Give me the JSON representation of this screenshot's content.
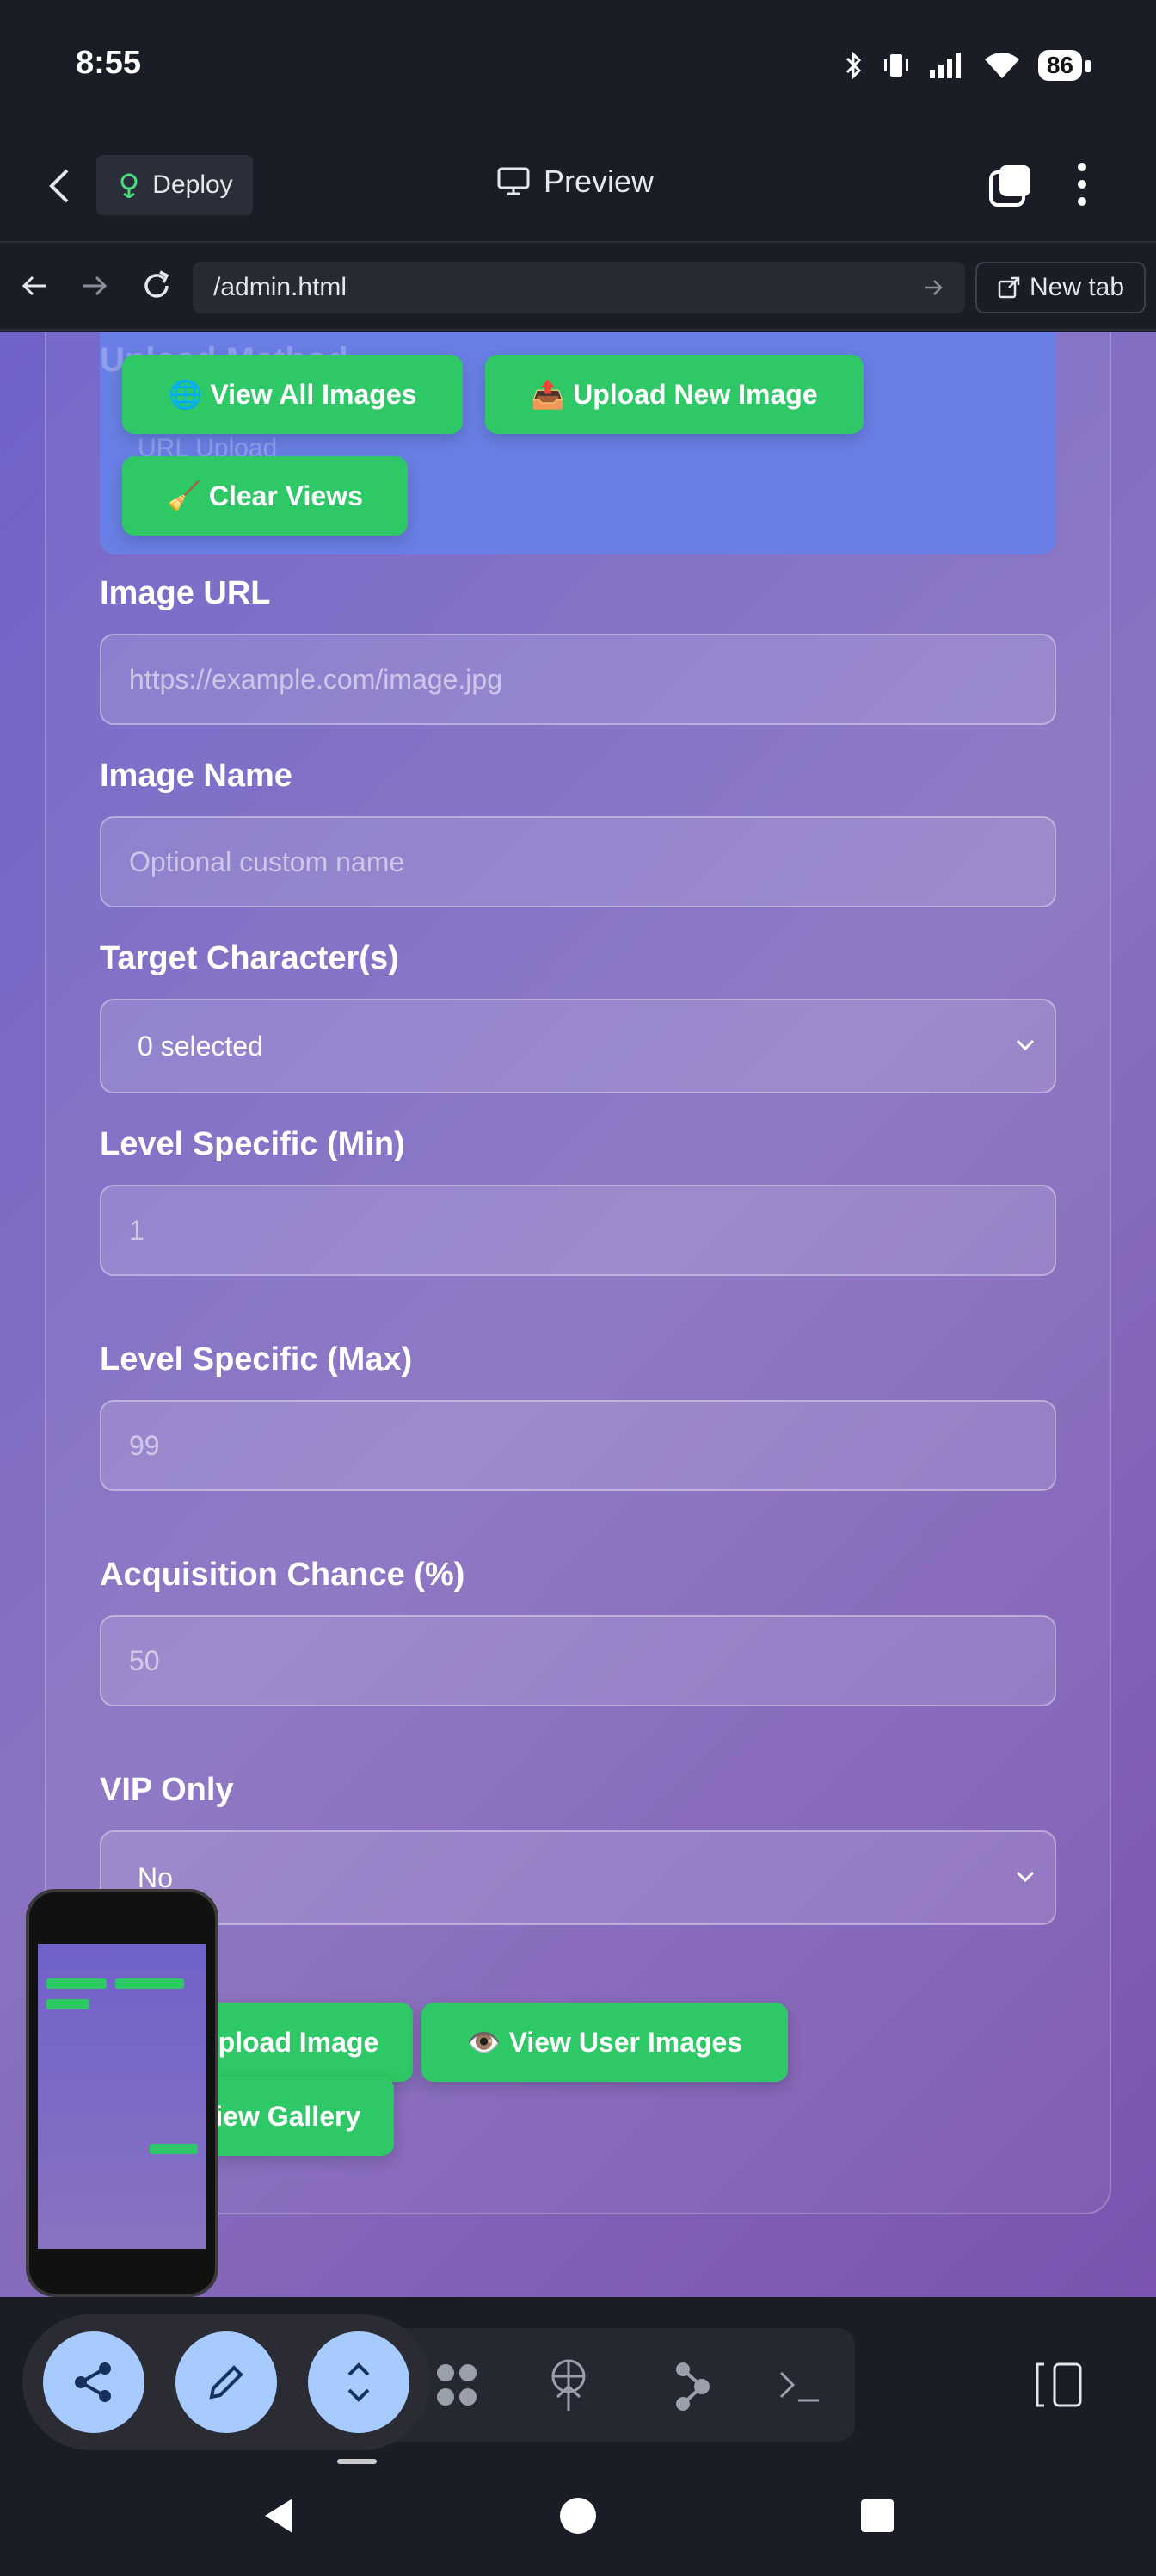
{
  "status_bar": {
    "time": "8:55",
    "battery": "86"
  },
  "app_bar": {
    "deploy_label": "Deploy",
    "title": "Preview"
  },
  "browser": {
    "url": "/admin.html",
    "new_tab_label": "New tab"
  },
  "page": {
    "ghost_heading": "Upload Method",
    "ghost_select": "URL Upload",
    "buttons": {
      "view_all": "🌐 View All Images",
      "upload_new": "📤 Upload New Image",
      "clear_views": "🧹 Clear Views"
    },
    "fields": {
      "image_url": {
        "label": "Image URL",
        "placeholder": "https://example.com/image.jpg"
      },
      "image_name": {
        "label": "Image Name",
        "placeholder": "Optional custom name"
      },
      "target_character": {
        "label": "Target Character(s)",
        "value": "0 selected"
      },
      "level_min": {
        "label": "Level Specific (Min)",
        "placeholder": "1"
      },
      "level_max": {
        "label": "Level Specific (Max)",
        "placeholder": "99"
      },
      "acquisition": {
        "label": "Acquisition Chance (%)",
        "placeholder": "50"
      },
      "vip": {
        "label": "VIP Only",
        "value": "No"
      }
    },
    "bottom_buttons": {
      "upload_image": "📤 Upload Image",
      "view_user_images": "👁️ View User Images",
      "view_gallery": "🖼️ View Gallery"
    }
  },
  "colors": {
    "accent_green": "#2fc866",
    "panel_blue": "#6a7fe6",
    "fab_blue": "#a7cbff"
  }
}
